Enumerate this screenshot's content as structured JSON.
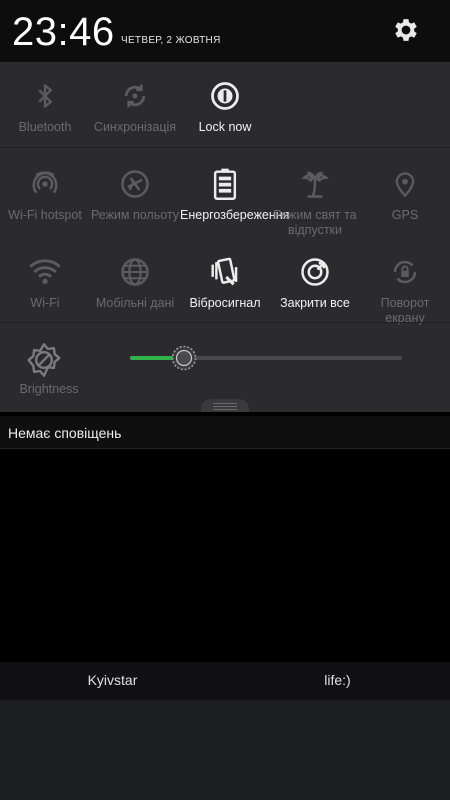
{
  "status": {
    "time": "23:46",
    "date": "ЧЕТВЕР, 2 ЖОВТНЯ",
    "settings_icon": "gear-icon"
  },
  "quick_settings": {
    "row1": [
      {
        "label": "Bluetooth",
        "icon": "bluetooth-icon",
        "active": false
      },
      {
        "label": "Синхронізація",
        "icon": "sync-icon",
        "active": false
      },
      {
        "label": "Lock now",
        "icon": "lock-now-icon",
        "active": true
      }
    ],
    "row2": [
      {
        "label": "Wi-Fi hotspot",
        "icon": "wifi-hotspot-icon",
        "active": false
      },
      {
        "label": "Режим польоту",
        "icon": "airplane-icon",
        "active": false
      },
      {
        "label": "Енергозбереження",
        "icon": "battery-icon",
        "active": true
      },
      {
        "label": "Режим свят та відпустки",
        "icon": "palm-tree-icon",
        "active": false
      },
      {
        "label": "GPS",
        "icon": "location-pin-icon",
        "active": false
      }
    ],
    "row3": [
      {
        "label": "Wi-Fi",
        "icon": "wifi-icon",
        "active": false
      },
      {
        "label": "Мобільні дані",
        "icon": "globe-icon",
        "active": false
      },
      {
        "label": "Вібросигнал",
        "icon": "vibrate-icon",
        "active": true
      },
      {
        "label": "Закрити все",
        "icon": "close-all-icon",
        "active": true
      },
      {
        "label": "Поворот екрану",
        "icon": "rotation-lock-icon",
        "active": false
      }
    ]
  },
  "brightness": {
    "label": "Brightness",
    "level": 0.2,
    "accent": "#2fb34a"
  },
  "notifications": {
    "empty_text": "Немає сповіщень"
  },
  "carriers": [
    "Kyivstar",
    "life:)"
  ]
}
